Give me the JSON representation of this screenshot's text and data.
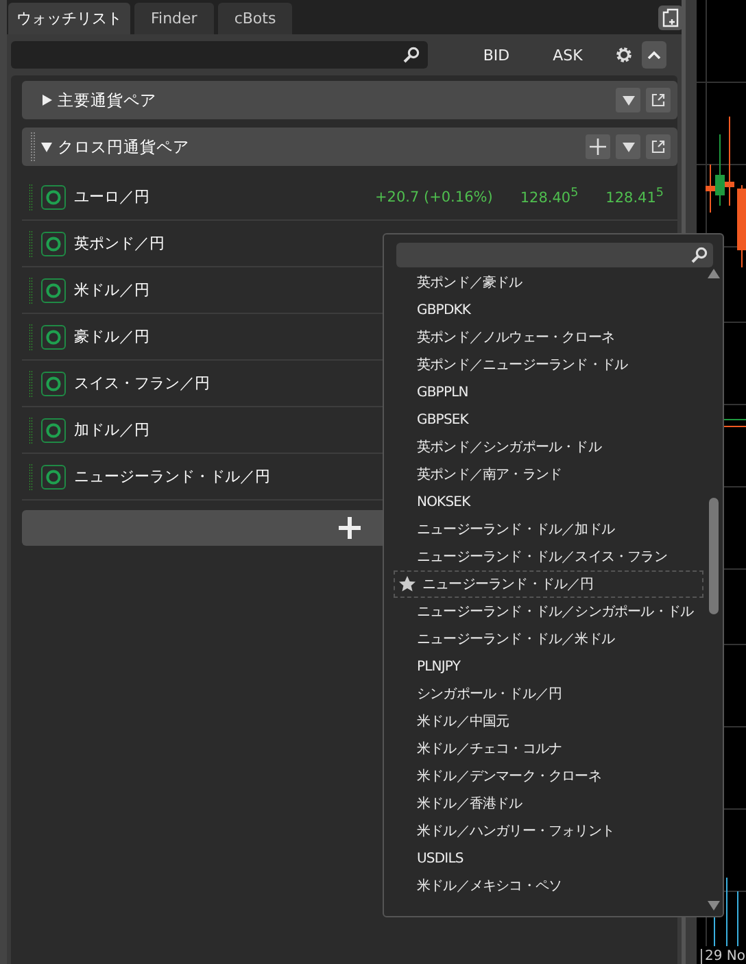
{
  "tabs": [
    {
      "label": "ウォッチリスト",
      "selected": true
    },
    {
      "label": "Finder",
      "selected": false
    },
    {
      "label": "cBots",
      "selected": false
    }
  ],
  "columns": [
    "BID",
    "ASK"
  ],
  "groups": [
    {
      "title": "主要通貨ペア",
      "expanded": false
    },
    {
      "title": "クロス円通貨ペア",
      "expanded": true,
      "symbols": [
        {
          "name": "ユーロ／円",
          "change": "+20.7 (+0.16%)",
          "bid": "128.40$^{5}$",
          "ask": "128.41$^{5}$"
        },
        {
          "name": "英ポンド／円"
        },
        {
          "name": "米ドル／円"
        },
        {
          "name": "豪ドル／円"
        },
        {
          "name": "スイス・フラン／円"
        },
        {
          "name": "加ドル／円"
        },
        {
          "name": "ニュージーランド・ドル／円"
        }
      ]
    }
  ],
  "popup": {
    "items": [
      {
        "label": "英ポンド／豪ドル",
        "selected": false
      },
      {
        "label": "GBPDKK",
        "selected": false
      },
      {
        "label": "英ポンド／ノルウェー・クローネ",
        "selected": false
      },
      {
        "label": "英ポンド／ニュージーランド・ドル",
        "selected": false
      },
      {
        "label": "GBPPLN",
        "selected": false
      },
      {
        "label": "GBPSEK",
        "selected": false
      },
      {
        "label": "英ポンド／シンガポール・ドル",
        "selected": false
      },
      {
        "label": "英ポンド／南ア・ランド",
        "selected": false
      },
      {
        "label": "NOKSEK",
        "selected": false
      },
      {
        "label": "ニュージーランド・ドル／加ドル",
        "selected": false
      },
      {
        "label": "ニュージーランド・ドル／スイス・フラン",
        "selected": false
      },
      {
        "label": "ニュージーランド・ドル／円",
        "selected": true
      },
      {
        "label": "ニュージーランド・ドル／シンガポール・ドル",
        "selected": false
      },
      {
        "label": "ニュージーランド・ドル／米ドル",
        "selected": false
      },
      {
        "label": "PLNJPY",
        "selected": false
      },
      {
        "label": "シンガポール・ドル／円",
        "selected": false
      },
      {
        "label": "米ドル／中国元",
        "selected": false
      },
      {
        "label": "米ドル／チェコ・コルナ",
        "selected": false
      },
      {
        "label": "米ドル／デンマーク・クローネ",
        "selected": false
      },
      {
        "label": "米ドル／香港ドル",
        "selected": false
      },
      {
        "label": "米ドル／ハンガリー・フォリント",
        "selected": false
      },
      {
        "label": "USDILS",
        "selected": false
      },
      {
        "label": "米ドル／メキシコ・ペソ",
        "selected": false
      }
    ]
  },
  "chart": {
    "date_label": "29 No"
  }
}
